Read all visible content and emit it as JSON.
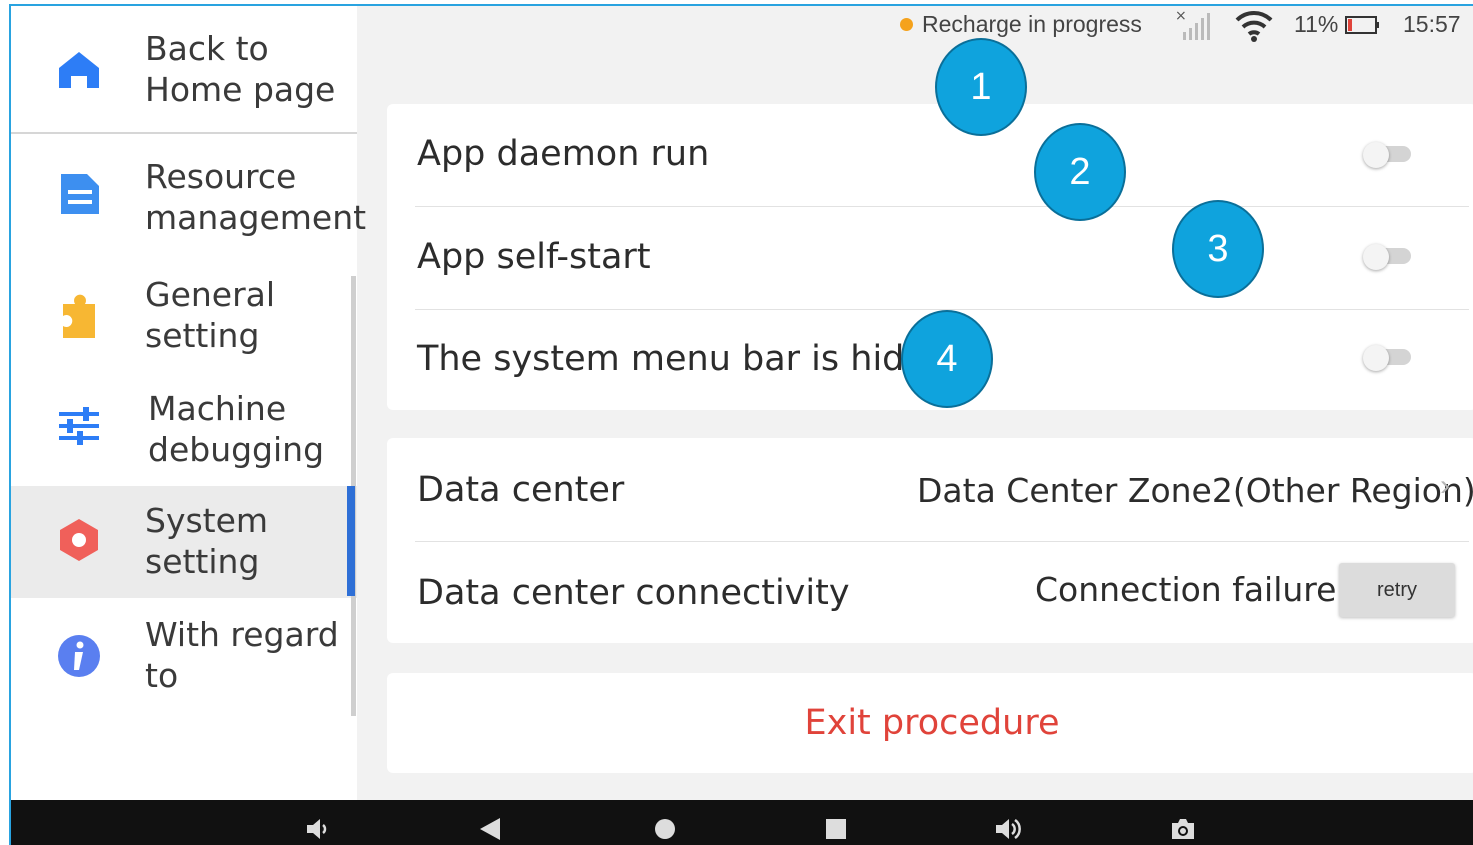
{
  "status_bar": {
    "charging_text": "Recharge in progress",
    "battery_percent": "11%",
    "time": "15:57",
    "charging_dot_color": "#f5a21c"
  },
  "sidebar": {
    "items": [
      {
        "label": "Back to\nHome page",
        "icon": "home-icon",
        "color": "#2d7df6"
      },
      {
        "label": "Resource\nmanagement",
        "icon": "document-icon",
        "color": "#3d8ff0"
      },
      {
        "label": "General\nsetting",
        "icon": "puzzle-icon",
        "color": "#f7b733"
      },
      {
        "label": "Machine\ndebugging",
        "icon": "sliders-icon",
        "color": "#2d7df6"
      },
      {
        "label": "System\nsetting",
        "icon": "hexagon-icon",
        "color": "#f0605a",
        "active": true
      },
      {
        "label": "With regard\nto",
        "icon": "info-icon",
        "color": "#5a7ff0"
      }
    ]
  },
  "settings": {
    "toggles": [
      {
        "label": "App daemon run",
        "on": false
      },
      {
        "label": "App self-start",
        "on": false
      },
      {
        "label": "The system menu bar is hidde",
        "on": false
      }
    ],
    "data_center": {
      "label": "Data center",
      "value": "Data Center Zone2(Other Region)"
    },
    "connectivity": {
      "label": "Data center connectivity",
      "value": "Connection failure",
      "retry_label": "retry"
    },
    "exit_label": "Exit procedure"
  },
  "callouts": [
    "1",
    "2",
    "3",
    "4"
  ],
  "nav_bar": {
    "icons": [
      "volume-down-icon",
      "back-icon",
      "home-circle-icon",
      "recents-icon",
      "volume-up-icon",
      "camera-icon"
    ]
  },
  "accent": "#2e6fd6",
  "danger": "#e0433a"
}
